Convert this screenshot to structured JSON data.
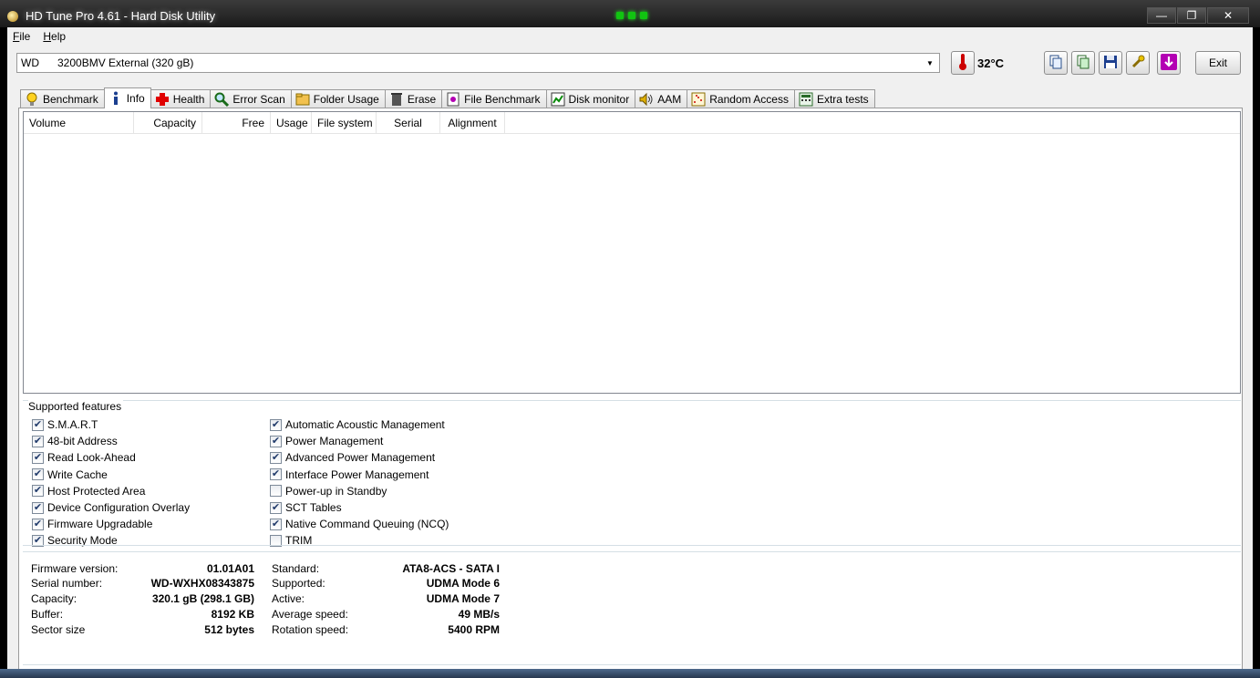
{
  "window": {
    "title": "HD Tune Pro 4.61 - Hard Disk Utility"
  },
  "menu": {
    "file": "File",
    "help": "Help"
  },
  "toolbar": {
    "drive": "WD      3200BMV External (320 gB)",
    "temperature": "32°C",
    "exit_label": "Exit"
  },
  "tabs": [
    {
      "label": "Benchmark",
      "icon": "lightbulb-icon"
    },
    {
      "label": "Info",
      "icon": "info-icon"
    },
    {
      "label": "Health",
      "icon": "health-cross-icon"
    },
    {
      "label": "Error Scan",
      "icon": "magnifier-icon"
    },
    {
      "label": "Folder Usage",
      "icon": "folder-icon"
    },
    {
      "label": "Erase",
      "icon": "trash-icon"
    },
    {
      "label": "File Benchmark",
      "icon": "file-benchmark-icon"
    },
    {
      "label": "Disk monitor",
      "icon": "chart-icon"
    },
    {
      "label": "AAM",
      "icon": "speaker-icon"
    },
    {
      "label": "Random Access",
      "icon": "scatter-icon"
    },
    {
      "label": "Extra tests",
      "icon": "calculator-icon"
    }
  ],
  "volume_table": {
    "columns": [
      "Volume",
      "Capacity",
      "Free",
      "Usage",
      "File system",
      "Serial",
      "Alignment"
    ]
  },
  "features": {
    "legend": "Supported features",
    "left": [
      {
        "label": "S.M.A.R.T",
        "checked": true
      },
      {
        "label": "48-bit Address",
        "checked": true
      },
      {
        "label": "Read Look-Ahead",
        "checked": true
      },
      {
        "label": "Write Cache",
        "checked": true
      },
      {
        "label": "Host Protected Area",
        "checked": true
      },
      {
        "label": "Device Configuration Overlay",
        "checked": true
      },
      {
        "label": "Firmware Upgradable",
        "checked": true
      },
      {
        "label": "Security Mode",
        "checked": true
      }
    ],
    "right": [
      {
        "label": "Automatic Acoustic Management",
        "checked": true
      },
      {
        "label": "Power Management",
        "checked": true
      },
      {
        "label": "Advanced Power Management",
        "checked": true
      },
      {
        "label": "Interface Power Management",
        "checked": true
      },
      {
        "label": "Power-up in Standby",
        "checked": false
      },
      {
        "label": "SCT Tables",
        "checked": true
      },
      {
        "label": "Native Command Queuing (NCQ)",
        "checked": true
      },
      {
        "label": "TRIM",
        "checked": false
      }
    ]
  },
  "info": {
    "left": [
      {
        "label": "Firmware version:",
        "value": "01.01A01"
      },
      {
        "label": "Serial number:",
        "value": "WD-WXHX08343875"
      },
      {
        "label": "Capacity:",
        "value": "320.1 gB (298.1 GB)"
      },
      {
        "label": "Buffer:",
        "value": "8192 KB"
      },
      {
        "label": "Sector size",
        "value": "512 bytes"
      }
    ],
    "right": [
      {
        "label": "Standard:",
        "value": "ATA8-ACS - SATA I"
      },
      {
        "label": "Supported:",
        "value": "UDMA Mode 6"
      },
      {
        "label": "Active:",
        "value": "UDMA Mode 7"
      },
      {
        "label": "Average speed:",
        "value": "49 MB/s"
      },
      {
        "label": "Rotation speed:",
        "value": "5400 RPM"
      }
    ]
  }
}
